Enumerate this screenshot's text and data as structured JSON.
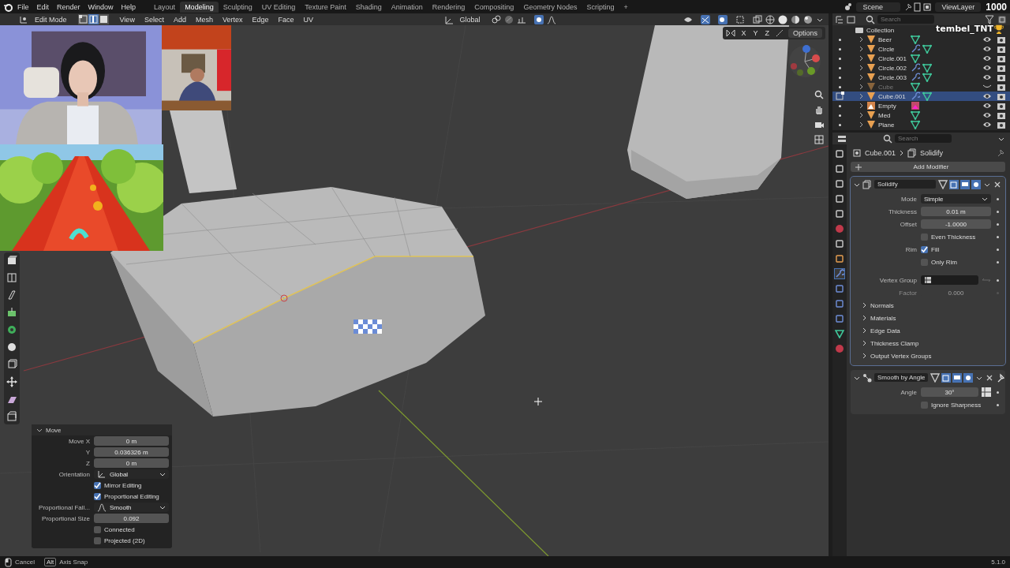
{
  "menu_bar": {
    "menus": [
      "File",
      "Edit",
      "Render",
      "Window",
      "Help"
    ],
    "workspaces": [
      {
        "label": "Layout",
        "selected": false
      },
      {
        "label": "Modeling",
        "selected": true
      },
      {
        "label": "Sculpting",
        "selected": false
      },
      {
        "label": "UV Editing",
        "selected": false
      },
      {
        "label": "Texture Paint",
        "selected": false
      },
      {
        "label": "Shading",
        "selected": false
      },
      {
        "label": "Animation",
        "selected": false
      },
      {
        "label": "Rendering",
        "selected": false
      },
      {
        "label": "Compositing",
        "selected": false
      },
      {
        "label": "Geometry Nodes",
        "selected": false
      },
      {
        "label": "Scripting",
        "selected": false
      }
    ],
    "add_tab": "+",
    "scene": "Scene",
    "view_layer": "ViewLayer"
  },
  "viewport_header": {
    "mode": "Edit Mode",
    "select_modes": [
      {
        "kind": "vertex",
        "selected": false
      },
      {
        "kind": "edge",
        "selected": true
      },
      {
        "kind": "face",
        "selected": false
      }
    ],
    "menus": [
      "View",
      "Select",
      "Add",
      "Mesh",
      "Vertex",
      "Edge",
      "Face",
      "UV"
    ],
    "orientation": "Global",
    "axes": [
      "X",
      "Y",
      "Z"
    ],
    "options": "Options"
  },
  "stream_overlay": {
    "counter": "1000",
    "username": "tembel_TNT"
  },
  "operator_panel": {
    "title": "Move",
    "rows": [
      {
        "kind": "number",
        "label": "Move X",
        "value": "0 m"
      },
      {
        "kind": "number",
        "label": "Y",
        "value": "0.036326 m"
      },
      {
        "kind": "number",
        "label": "Z",
        "value": "0 m"
      },
      {
        "kind": "dropdown",
        "label": "Orientation",
        "value": "Global"
      },
      {
        "kind": "checkbox",
        "value": "Mirror Editing",
        "checked": true
      },
      {
        "kind": "checkbox",
        "value": "Proportional Editing",
        "checked": true
      },
      {
        "kind": "dropdown",
        "label": "Proportional Fall...",
        "value": "Smooth"
      },
      {
        "kind": "number",
        "label": "Proportional Size",
        "value": "0.092"
      },
      {
        "kind": "checkbox",
        "value": "Connected",
        "checked": false
      },
      {
        "kind": "checkbox",
        "value": "Projected (2D)",
        "checked": false
      }
    ]
  },
  "outliner": {
    "search_placeholder": "Search",
    "collection": "Collection",
    "items": [
      {
        "name": "Beer",
        "kind": "mesh",
        "modifier": false,
        "selected": false,
        "hidden": false
      },
      {
        "name": "Circle",
        "kind": "mesh",
        "modifier": true,
        "selected": false,
        "hidden": false
      },
      {
        "name": "Circle.001",
        "kind": "mesh",
        "modifier": false,
        "selected": false,
        "hidden": false
      },
      {
        "name": "Circle.002",
        "kind": "mesh",
        "modifier": true,
        "selected": false,
        "hidden": false
      },
      {
        "name": "Circle.003",
        "kind": "mesh",
        "modifier": true,
        "selected": false,
        "hidden": false
      },
      {
        "name": "Cube",
        "kind": "mesh",
        "modifier": false,
        "selected": false,
        "hidden": true
      },
      {
        "name": "Cube.001",
        "kind": "mesh",
        "modifier": true,
        "selected": true,
        "hidden": false
      },
      {
        "name": "Empty",
        "kind": "empty",
        "modifier": false,
        "selected": false,
        "hidden": false
      },
      {
        "name": "Med",
        "kind": "mesh",
        "modifier": false,
        "selected": false,
        "hidden": false
      },
      {
        "name": "Plane",
        "kind": "mesh",
        "modifier": false,
        "selected": false,
        "hidden": false
      }
    ]
  },
  "properties": {
    "search_placeholder": "Search",
    "breadcrumb": [
      "Cube.001",
      "Solidify"
    ],
    "add_modifier": "Add Modifier",
    "modifiers": [
      {
        "name": "Solidify",
        "kind": "solidify",
        "rows": [
          {
            "kind": "dropdown",
            "label": "Mode",
            "value": "Simple"
          },
          {
            "kind": "number",
            "label": "Thickness",
            "value": "0.01 m"
          },
          {
            "kind": "number",
            "label": "Offset",
            "value": "-1.0000"
          },
          {
            "kind": "checkbox",
            "value": "Even Thickness",
            "checked": false
          },
          {
            "kind": "checkbox",
            "label": "Rim",
            "value": "Fill",
            "checked": true
          },
          {
            "kind": "checkbox",
            "value": "Only Rim",
            "checked": false
          },
          {
            "kind": "group",
            "label": "Vertex Group"
          },
          {
            "kind": "number",
            "label": "Factor",
            "value": "0.000",
            "disabled": true
          }
        ],
        "sections": [
          "Normals",
          "Materials",
          "Edge Data",
          "Thickness Clamp",
          "Output Vertex Groups"
        ]
      },
      {
        "name": "Smooth by Angle",
        "kind": "nodes",
        "rows": [
          {
            "kind": "number",
            "label": "Angle",
            "value": "30°"
          },
          {
            "kind": "checkbox",
            "value": "Ignore Sharpness",
            "checked": false
          }
        ]
      }
    ]
  },
  "status_bar": {
    "cancel": "Cancel",
    "key": "Alt",
    "action": "Axis Snap",
    "version": "5.1.0"
  }
}
